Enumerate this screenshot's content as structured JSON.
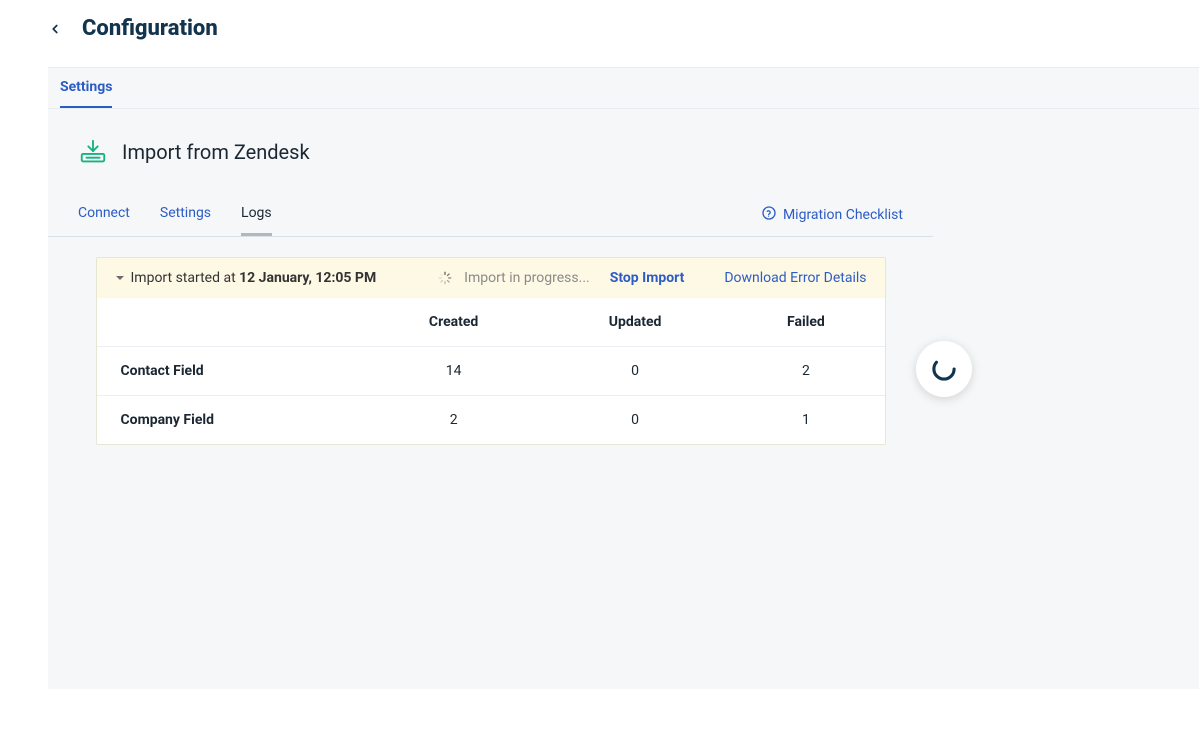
{
  "header": {
    "title": "Configuration"
  },
  "topTabs": {
    "settings": "Settings"
  },
  "panel": {
    "title": "Import from Zendesk"
  },
  "subTabs": {
    "connect": "Connect",
    "settings": "Settings",
    "logs": "Logs"
  },
  "migrationLink": "Migration Checklist",
  "statusBar": {
    "prefix": "Import started at ",
    "timestamp": "12 January, 12:05 PM",
    "progress": "Import in progress...",
    "stop": "Stop Import",
    "download": "Download Error Details"
  },
  "table": {
    "headers": {
      "created": "Created",
      "updated": "Updated",
      "failed": "Failed"
    },
    "rows": [
      {
        "name": "Contact Field",
        "created": "14",
        "updated": "0",
        "failed": "2"
      },
      {
        "name": "Company Field",
        "created": "2",
        "updated": "0",
        "failed": "1"
      }
    ]
  }
}
